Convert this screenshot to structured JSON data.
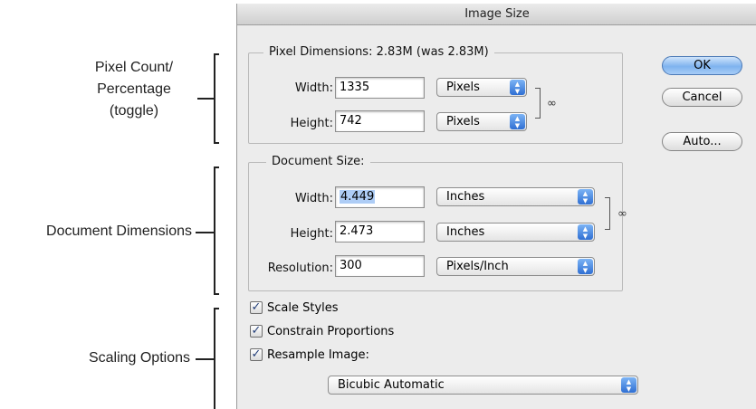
{
  "annotations": {
    "pixel_count": [
      "Pixel Count/",
      "Percentage",
      "(toggle)"
    ],
    "document_dimensions": "Document Dimensions",
    "scaling_options": "Scaling Options"
  },
  "dialog": {
    "title": "Image Size",
    "pixel_dimensions": {
      "legend": "Pixel Dimensions:  2.83M (was 2.83M)",
      "width_label": "Width:",
      "width_value": "1335",
      "width_unit": "Pixels",
      "height_label": "Height:",
      "height_value": "742",
      "height_unit": "Pixels"
    },
    "document_size": {
      "legend": "Document Size:",
      "width_label": "Width:",
      "width_value": "4.449",
      "width_unit": "Inches",
      "height_label": "Height:",
      "height_value": "2.473",
      "height_unit": "Inches",
      "resolution_label": "Resolution:",
      "resolution_value": "300",
      "resolution_unit": "Pixels/Inch"
    },
    "buttons": {
      "ok": "OK",
      "cancel": "Cancel",
      "auto": "Auto..."
    },
    "options": {
      "scale_styles": {
        "label": "Scale Styles",
        "checked": true
      },
      "constrain_proportions": {
        "label": "Constrain Proportions",
        "checked": true
      },
      "resample_image": {
        "label": "Resample Image:",
        "checked": true
      },
      "resample_method": "Bicubic Automatic"
    },
    "icons": {
      "link": "chain-link-icon",
      "stepper": "stepper-arrows-icon",
      "check": "checkmark-icon"
    }
  }
}
